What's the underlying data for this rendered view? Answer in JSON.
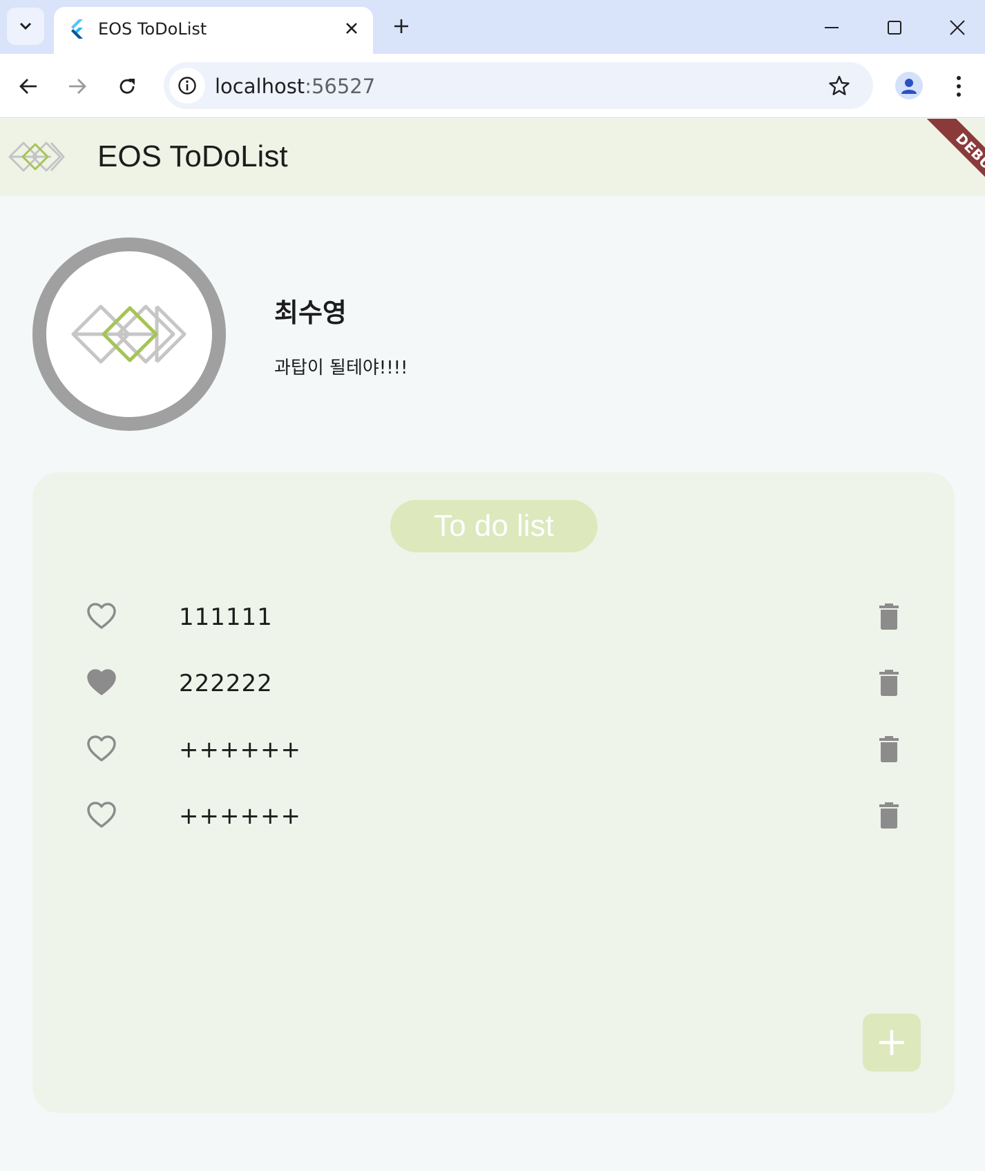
{
  "browser": {
    "tab_title": "EOS ToDoList",
    "url_host": "localhost",
    "url_port": ":56527",
    "icons": {
      "tab_list": "chevron-down-icon",
      "favicon": "flutter-icon",
      "tab_close": "close-icon",
      "new_tab": "plus-icon",
      "minimize": "minimize-icon",
      "maximize": "maximize-icon",
      "close_window": "close-icon",
      "back": "back-arrow-icon",
      "forward": "forward-arrow-icon",
      "reload": "reload-icon",
      "site_info": "info-icon",
      "bookmark": "star-icon",
      "profile": "person-icon",
      "menu": "kebab-menu-icon"
    }
  },
  "app": {
    "title": "EOS ToDoList",
    "debug_label": "DEBUG",
    "profile": {
      "name": "최수영",
      "status": "과탑이 될테야!!!!"
    },
    "todo": {
      "header": "To do list",
      "items": [
        {
          "text": "111111",
          "favorite": false
        },
        {
          "text": "222222",
          "favorite": true
        },
        {
          "text": "++++++",
          "favorite": false
        },
        {
          "text": "++++++",
          "favorite": false
        }
      ],
      "add_icon": "plus-icon",
      "delete_icon": "trash-icon"
    },
    "colors": {
      "appbar_bg": "#eef3e6",
      "card_bg": "#eef4e9",
      "accent": "#dde8bd",
      "logo_green": "#a6c454",
      "icon_gray": "#8c8c8c",
      "debug_red": "#8b3a3a"
    }
  }
}
